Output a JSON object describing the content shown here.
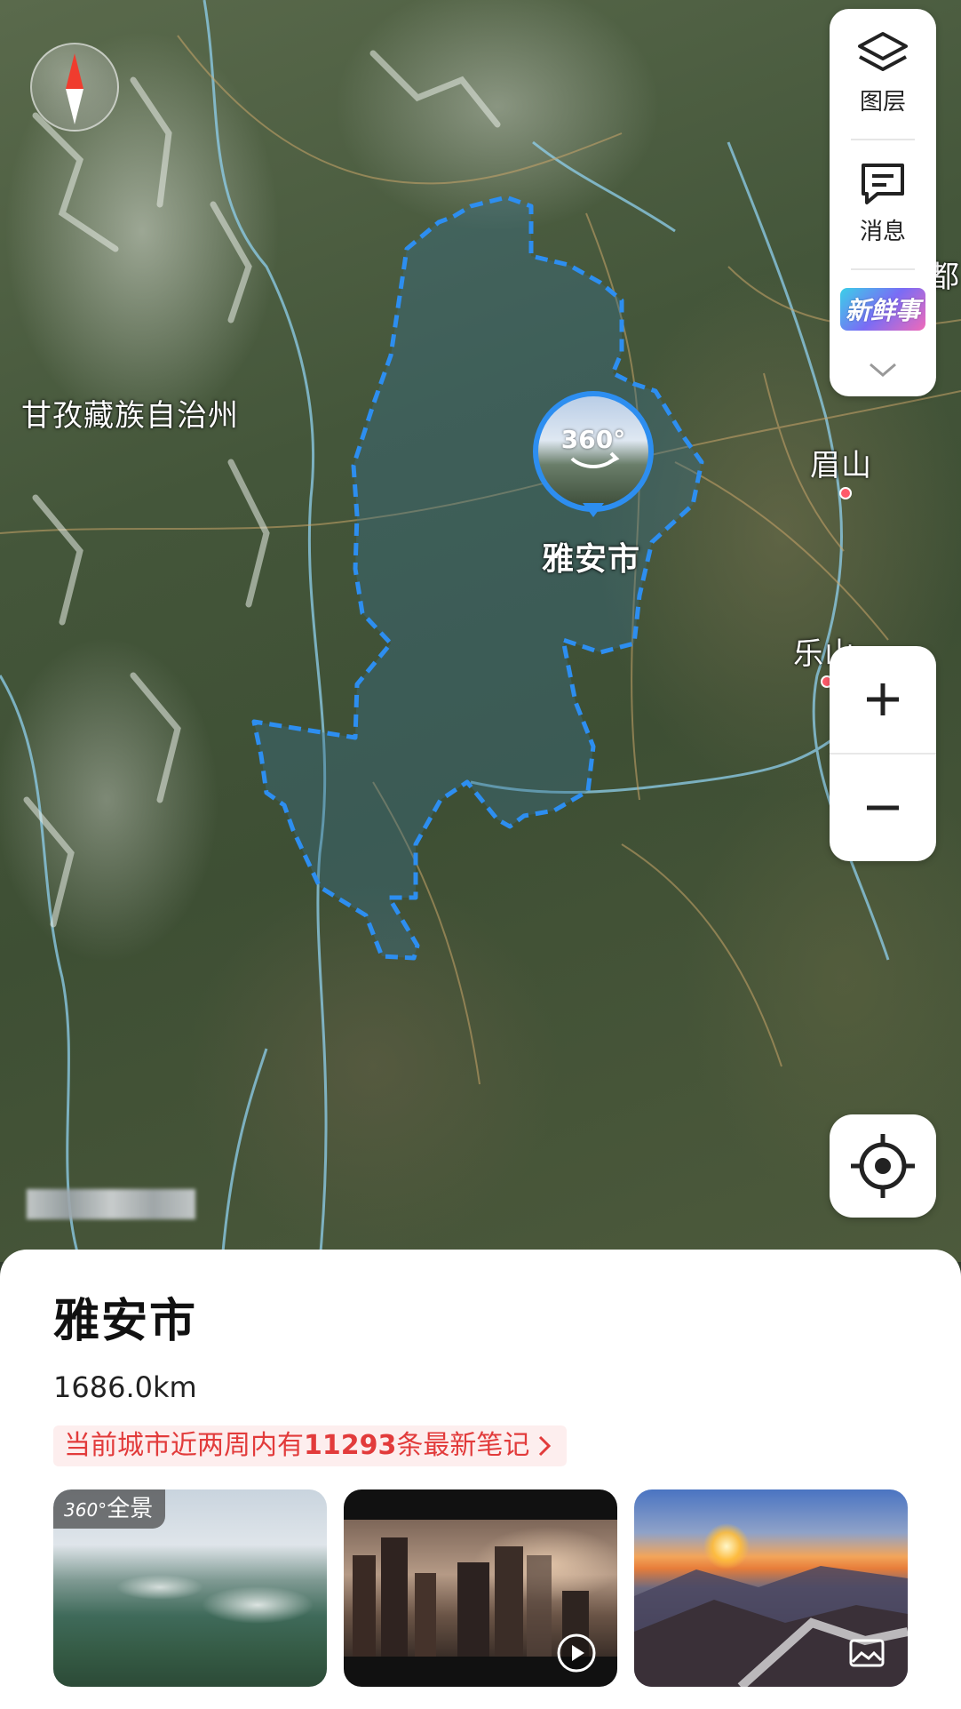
{
  "map": {
    "labels": {
      "region_west": "甘孜藏族自治州",
      "city_meishan": "眉山",
      "city_leshan": "乐山",
      "selected_city": "雅安市",
      "edge_partial": "都"
    },
    "pin_badge": "360°",
    "colors": {
      "boundary": "#2d8ef0",
      "city_dot": "#ff5a6a"
    }
  },
  "controls": {
    "layers_label": "图层",
    "messages_label": "消息",
    "fresh_label": "新鲜事",
    "icons": [
      "layers-icon",
      "message-icon",
      "chevron-down-icon",
      "zoom-in-icon",
      "zoom-out-icon",
      "locate-icon",
      "compass-icon"
    ]
  },
  "sheet": {
    "title": "雅安市",
    "distance": "1686.0km",
    "notes_prefix": "当前城市近两周内有",
    "notes_count": "11293",
    "notes_suffix": "条最新笔记",
    "notes_color": "#e23b3b",
    "thumbnails": [
      {
        "badge": "全景",
        "badge_prefix": "360°",
        "kind": "panorama"
      },
      {
        "kind": "video",
        "icon": "play-icon"
      },
      {
        "kind": "photo",
        "icon": "image-icon"
      }
    ]
  }
}
